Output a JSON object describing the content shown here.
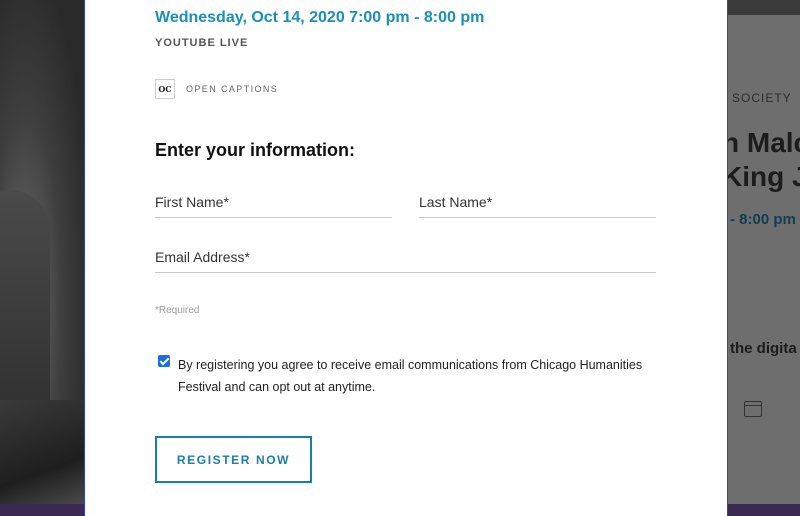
{
  "event": {
    "date_time": "Wednesday, Oct 14, 2020 7:00 pm - 8:00 pm",
    "venue": "YOUTUBE LIVE",
    "badge_abbr": "OC",
    "badge_label": "OPEN CAPTIONS"
  },
  "form": {
    "heading": "Enter your information:",
    "first_name_placeholder": "First Name*",
    "last_name_placeholder": "Last Name*",
    "email_placeholder": "Email Address*",
    "required_note": "*Required",
    "consent_checked": true,
    "consent_text": "By registering you agree to receive email communications from Chicago Humanities Festival and can opt out at anytime.",
    "submit_label": "REGISTER NOW"
  },
  "background_page": {
    "society_label": "SOCIETY",
    "title_line1": "n Malc",
    "title_line2": "King J",
    "time_fragment": "- 8:00 pm",
    "digital_fragment": "the digita"
  },
  "colors": {
    "accent": "#1a8fb8",
    "button_border": "#1a7fa8",
    "modal_border": "#3340c4",
    "checkbox": "#1a6fe0"
  },
  "icons": {
    "background_calendar": "calendar-icon",
    "consent_checkbox": "checkmark-icon"
  }
}
